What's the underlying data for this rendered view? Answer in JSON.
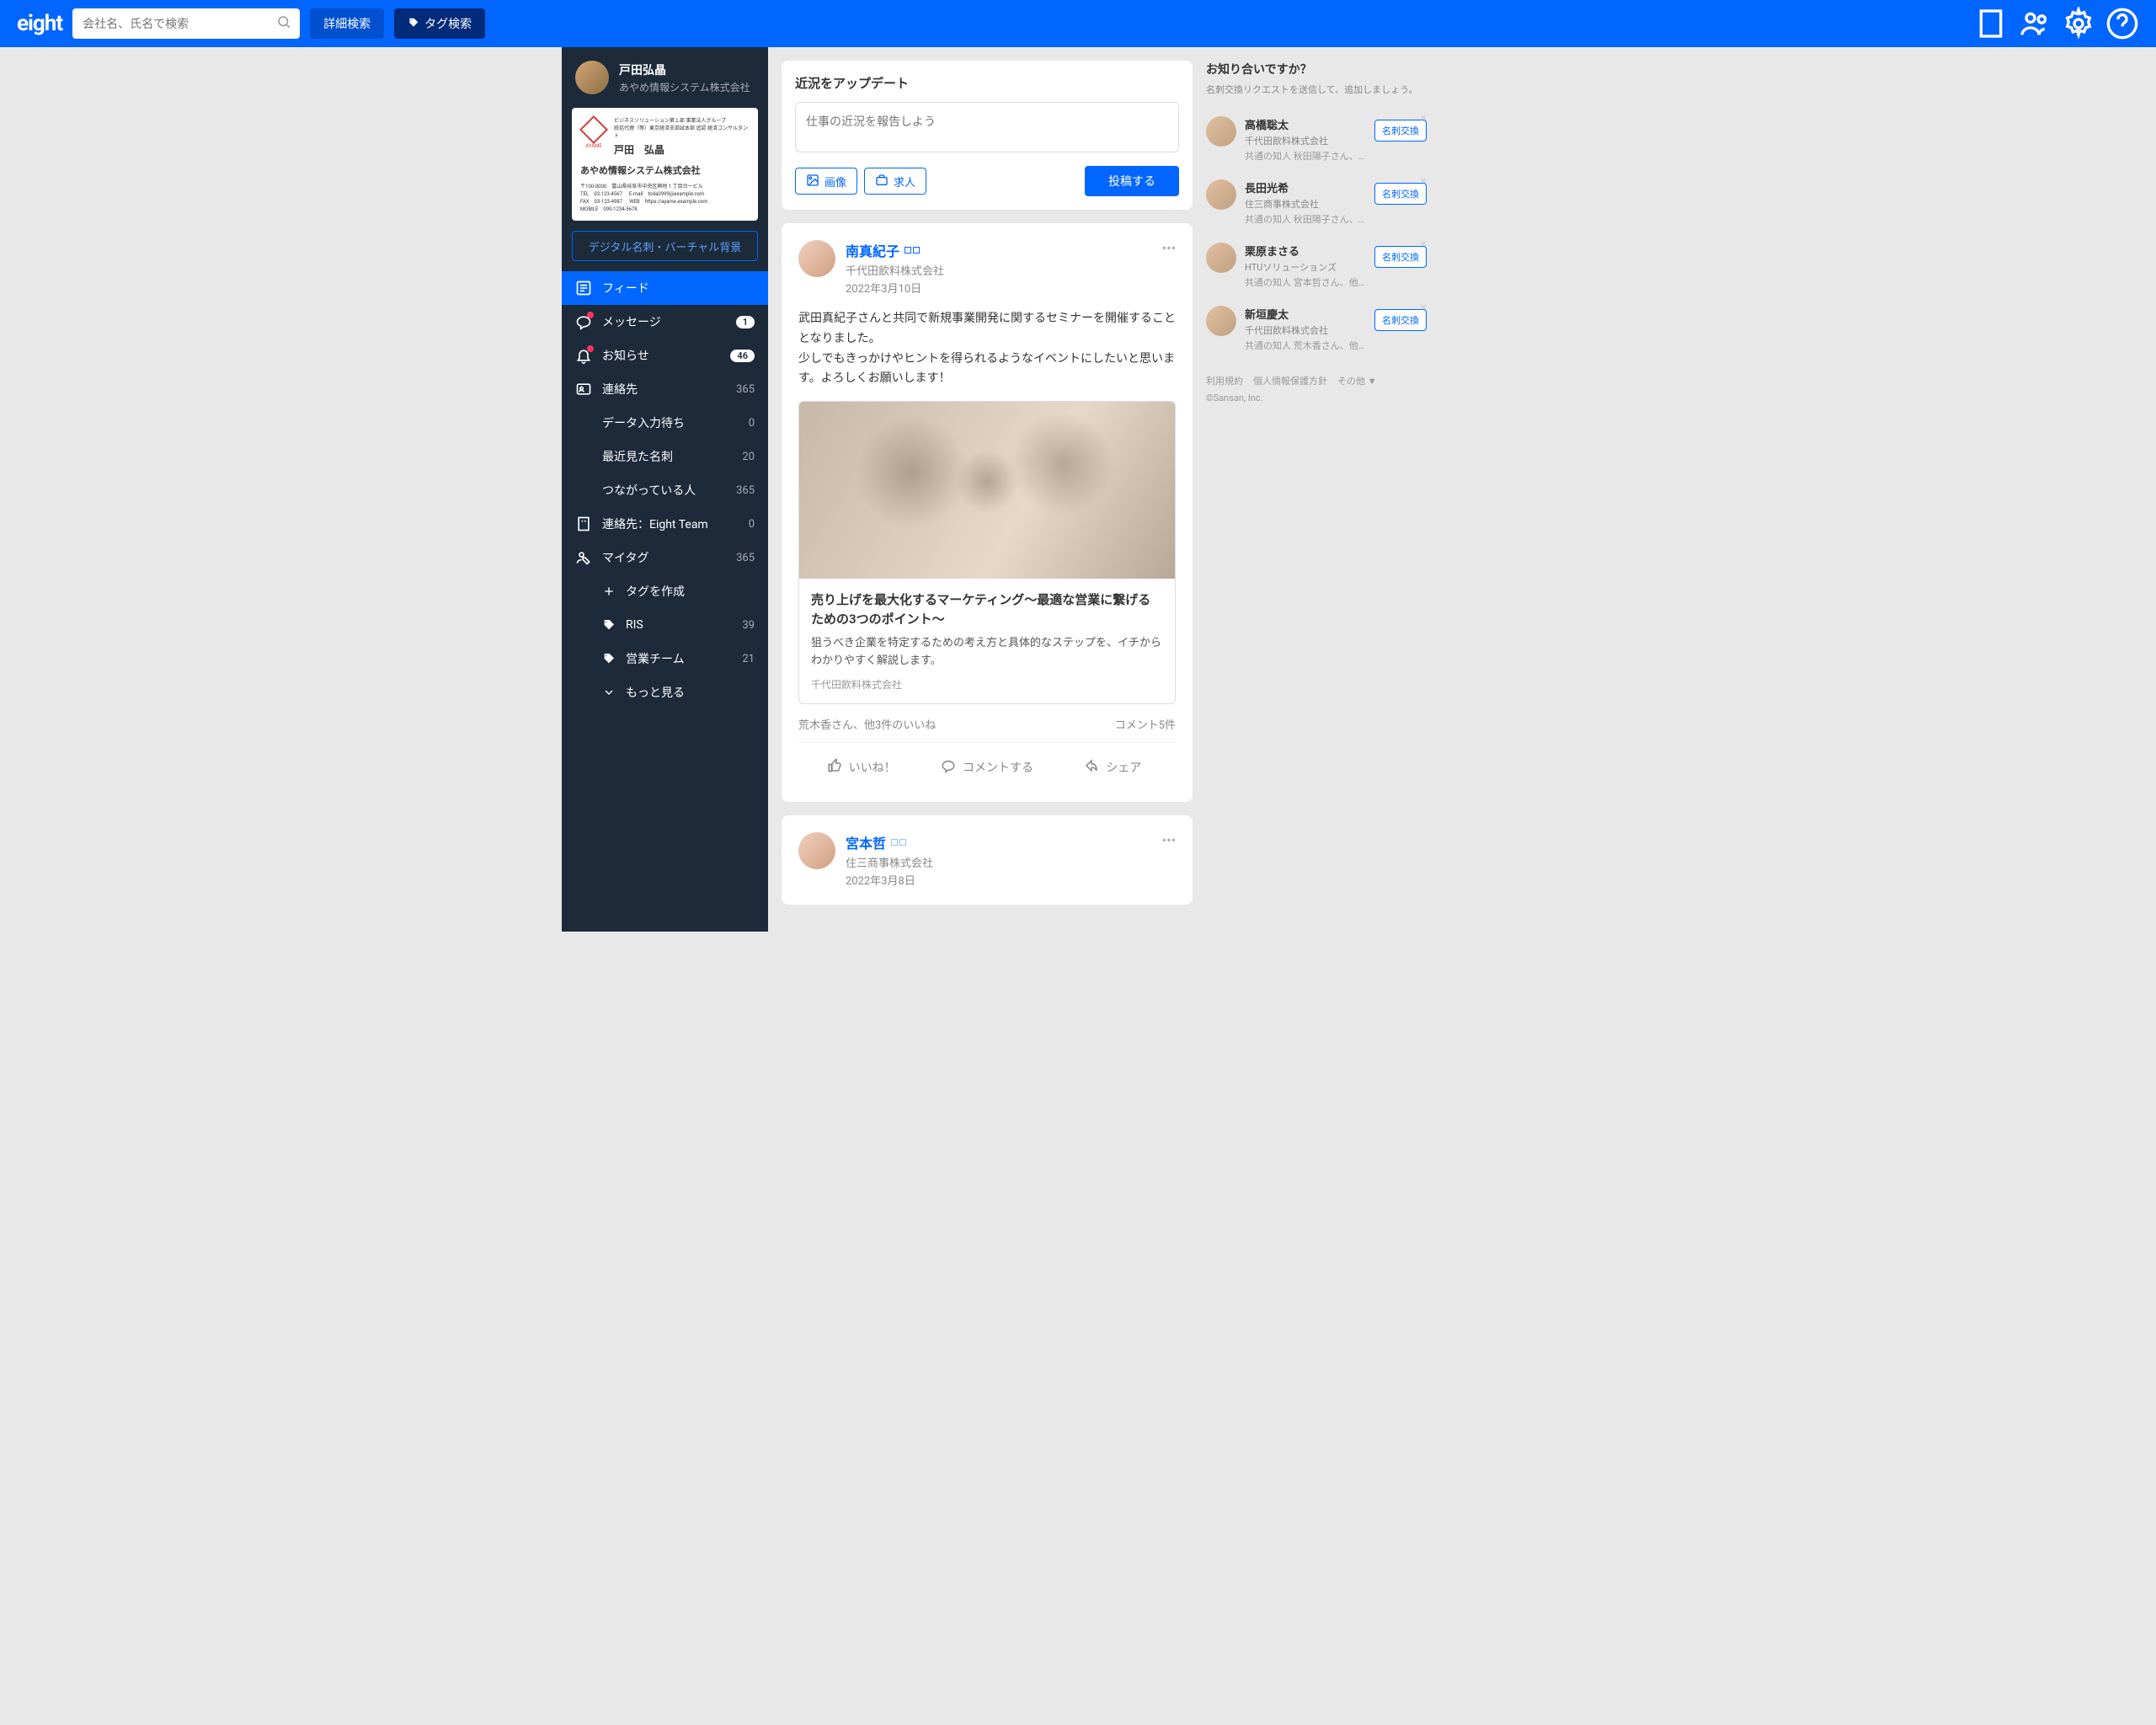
{
  "header": {
    "logo": "eight",
    "search_placeholder": "会社名、氏名で検索",
    "detail_search": "詳細検索",
    "tag_search": "タグ検索"
  },
  "profile": {
    "name": "戸田弘晶",
    "company": "あやめ情報システム株式会社"
  },
  "bizcard": {
    "logo_text": "AYAME",
    "dept": "ビジネスソリューション第１部 事業法人グループ",
    "title": "統括代理（等）東京経済支部試本部 追認 経済コンサルタント",
    "name": "戸田　弘晶",
    "company": "あやめ情報システム株式会社",
    "addr": "〒100-0000　富山県岐阜市中央区興地 1 丁目台一ビル",
    "tel": "TEL　03-123-4567",
    "fax": "FAX　03-123-4987",
    "email": "E-mail　toda0999@example.com",
    "mobile": "MOBILE　090-1234-5678",
    "web": "WEB　https://ayame.example.com"
  },
  "digital_btn": "デジタル名刺・バーチャル背景",
  "nav": {
    "feed": "フィード",
    "messages": "メッセージ",
    "messages_badge": "1",
    "notices": "お知らせ",
    "notices_badge": "46",
    "contacts": "連絡先",
    "contacts_count": "365",
    "pending": "データ入力待ち",
    "pending_count": "0",
    "recent": "最近見た名刺",
    "recent_count": "20",
    "connected": "つながっている人",
    "connected_count": "365",
    "team": "連絡先：Eight Team",
    "team_count": "0",
    "mytag": "マイタグ",
    "mytag_count": "365",
    "create_tag": "タグを作成",
    "tag_ris": "RIS",
    "tag_ris_count": "39",
    "tag_sales": "営業チーム",
    "tag_sales_count": "21",
    "more": "もっと見る"
  },
  "composer": {
    "title": "近況をアップデート",
    "placeholder": "仕事の近況を報告しよう",
    "image": "画像",
    "job": "求人",
    "post": "投稿する"
  },
  "post1": {
    "name": "南真紀子",
    "company": "千代田飲料株式会社",
    "date": "2022年3月10日",
    "body": "武田真紀子さんと共同で新規事業開発に関するセミナーを開催することとなりました。\n少しでもきっかけやヒントを得られるようなイベントにしたいと思います。よろしくお願いします！",
    "card_title": "売り上げを最大化するマーケティング〜最適な営業に繋げるための3つのポイント〜",
    "card_desc": "狙うべき企業を特定するための考え方と具体的なステップを、イチからわかりやすく解説します。",
    "card_src": "千代田飲料株式会社",
    "likes": "荒木香さん、他3件のいいね",
    "comments": "コメント5件",
    "like_label": "いいね！",
    "comment_label": "コメントする",
    "share_label": "シェア"
  },
  "post2": {
    "name": "宮本哲",
    "company": "住三商事株式会社",
    "date": "2022年3月8日"
  },
  "rightbar": {
    "title": "お知り合いですか？",
    "sub": "名刺交換リクエストを送信して、追加しましょう。",
    "exchange": "名刺交換",
    "suggestions": [
      {
        "name": "高橋聡太",
        "company": "千代田飲料株式会社",
        "mutual": "共通の知人 秋田陽子さん、…"
      },
      {
        "name": "長田光希",
        "company": "住三商事株式会社",
        "mutual": "共通の知人 秋田陽子さん、他…"
      },
      {
        "name": "栗原まさる",
        "company": "HTUソリューションズ",
        "mutual": "共通の知人 宮本哲さん、他…"
      },
      {
        "name": "新垣慶太",
        "company": "千代田飲料株式会社",
        "mutual": "共通の知人 荒木香さん、他…"
      }
    ],
    "footer": {
      "terms": "利用規約",
      "privacy": "個人情報保護方針",
      "other": "その他 ▼",
      "copy": "©Sansan, Inc."
    }
  }
}
